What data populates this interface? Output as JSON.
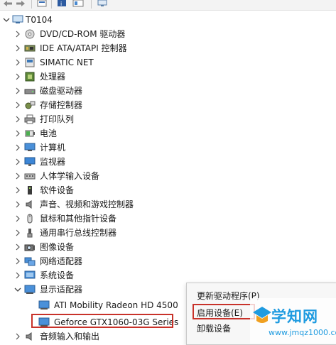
{
  "tree": {
    "root": "T0104",
    "items": [
      {
        "label": "DVD/CD-ROM 驱动器",
        "icon": "dvd-drive-icon"
      },
      {
        "label": "IDE ATA/ATAPI 控制器",
        "icon": "ide-controller-icon"
      },
      {
        "label": "SIMATIC NET",
        "icon": "network-component-icon"
      },
      {
        "label": "处理器",
        "icon": "processor-icon"
      },
      {
        "label": "磁盘驱动器",
        "icon": "disk-drive-icon"
      },
      {
        "label": "存储控制器",
        "icon": "storage-controller-icon"
      },
      {
        "label": "打印队列",
        "icon": "printer-icon"
      },
      {
        "label": "电池",
        "icon": "battery-icon"
      },
      {
        "label": "计算机",
        "icon": "computer-icon"
      },
      {
        "label": "监视器",
        "icon": "monitor-icon"
      },
      {
        "label": "人体学输入设备",
        "icon": "hid-icon"
      },
      {
        "label": "软件设备",
        "icon": "software-device-icon"
      },
      {
        "label": "声音、视频和游戏控制器",
        "icon": "speaker-icon"
      },
      {
        "label": "鼠标和其他指针设备",
        "icon": "mouse-icon"
      },
      {
        "label": "通用串行总线控制器",
        "icon": "usb-icon"
      },
      {
        "label": "图像设备",
        "icon": "camera-icon"
      },
      {
        "label": "网络适配器",
        "icon": "network-adapter-icon"
      },
      {
        "label": "系统设备",
        "icon": "system-device-icon"
      },
      {
        "label": "显示适配器",
        "icon": "display-adapter-icon"
      }
    ],
    "display_children": [
      "ATI Mobility Radeon HD 4500",
      "Geforce GTX1060-03G Series"
    ],
    "last_item": "音频输入和输出"
  },
  "context_menu": {
    "items": [
      "更新驱动程序(P)",
      "启用设备(E)",
      "卸载设备"
    ]
  },
  "watermark": {
    "brand": "学知网",
    "url": "www.jmqz1000.com"
  },
  "colors": {
    "highlight": "#c8322a",
    "watermark": "#1f9be0"
  }
}
